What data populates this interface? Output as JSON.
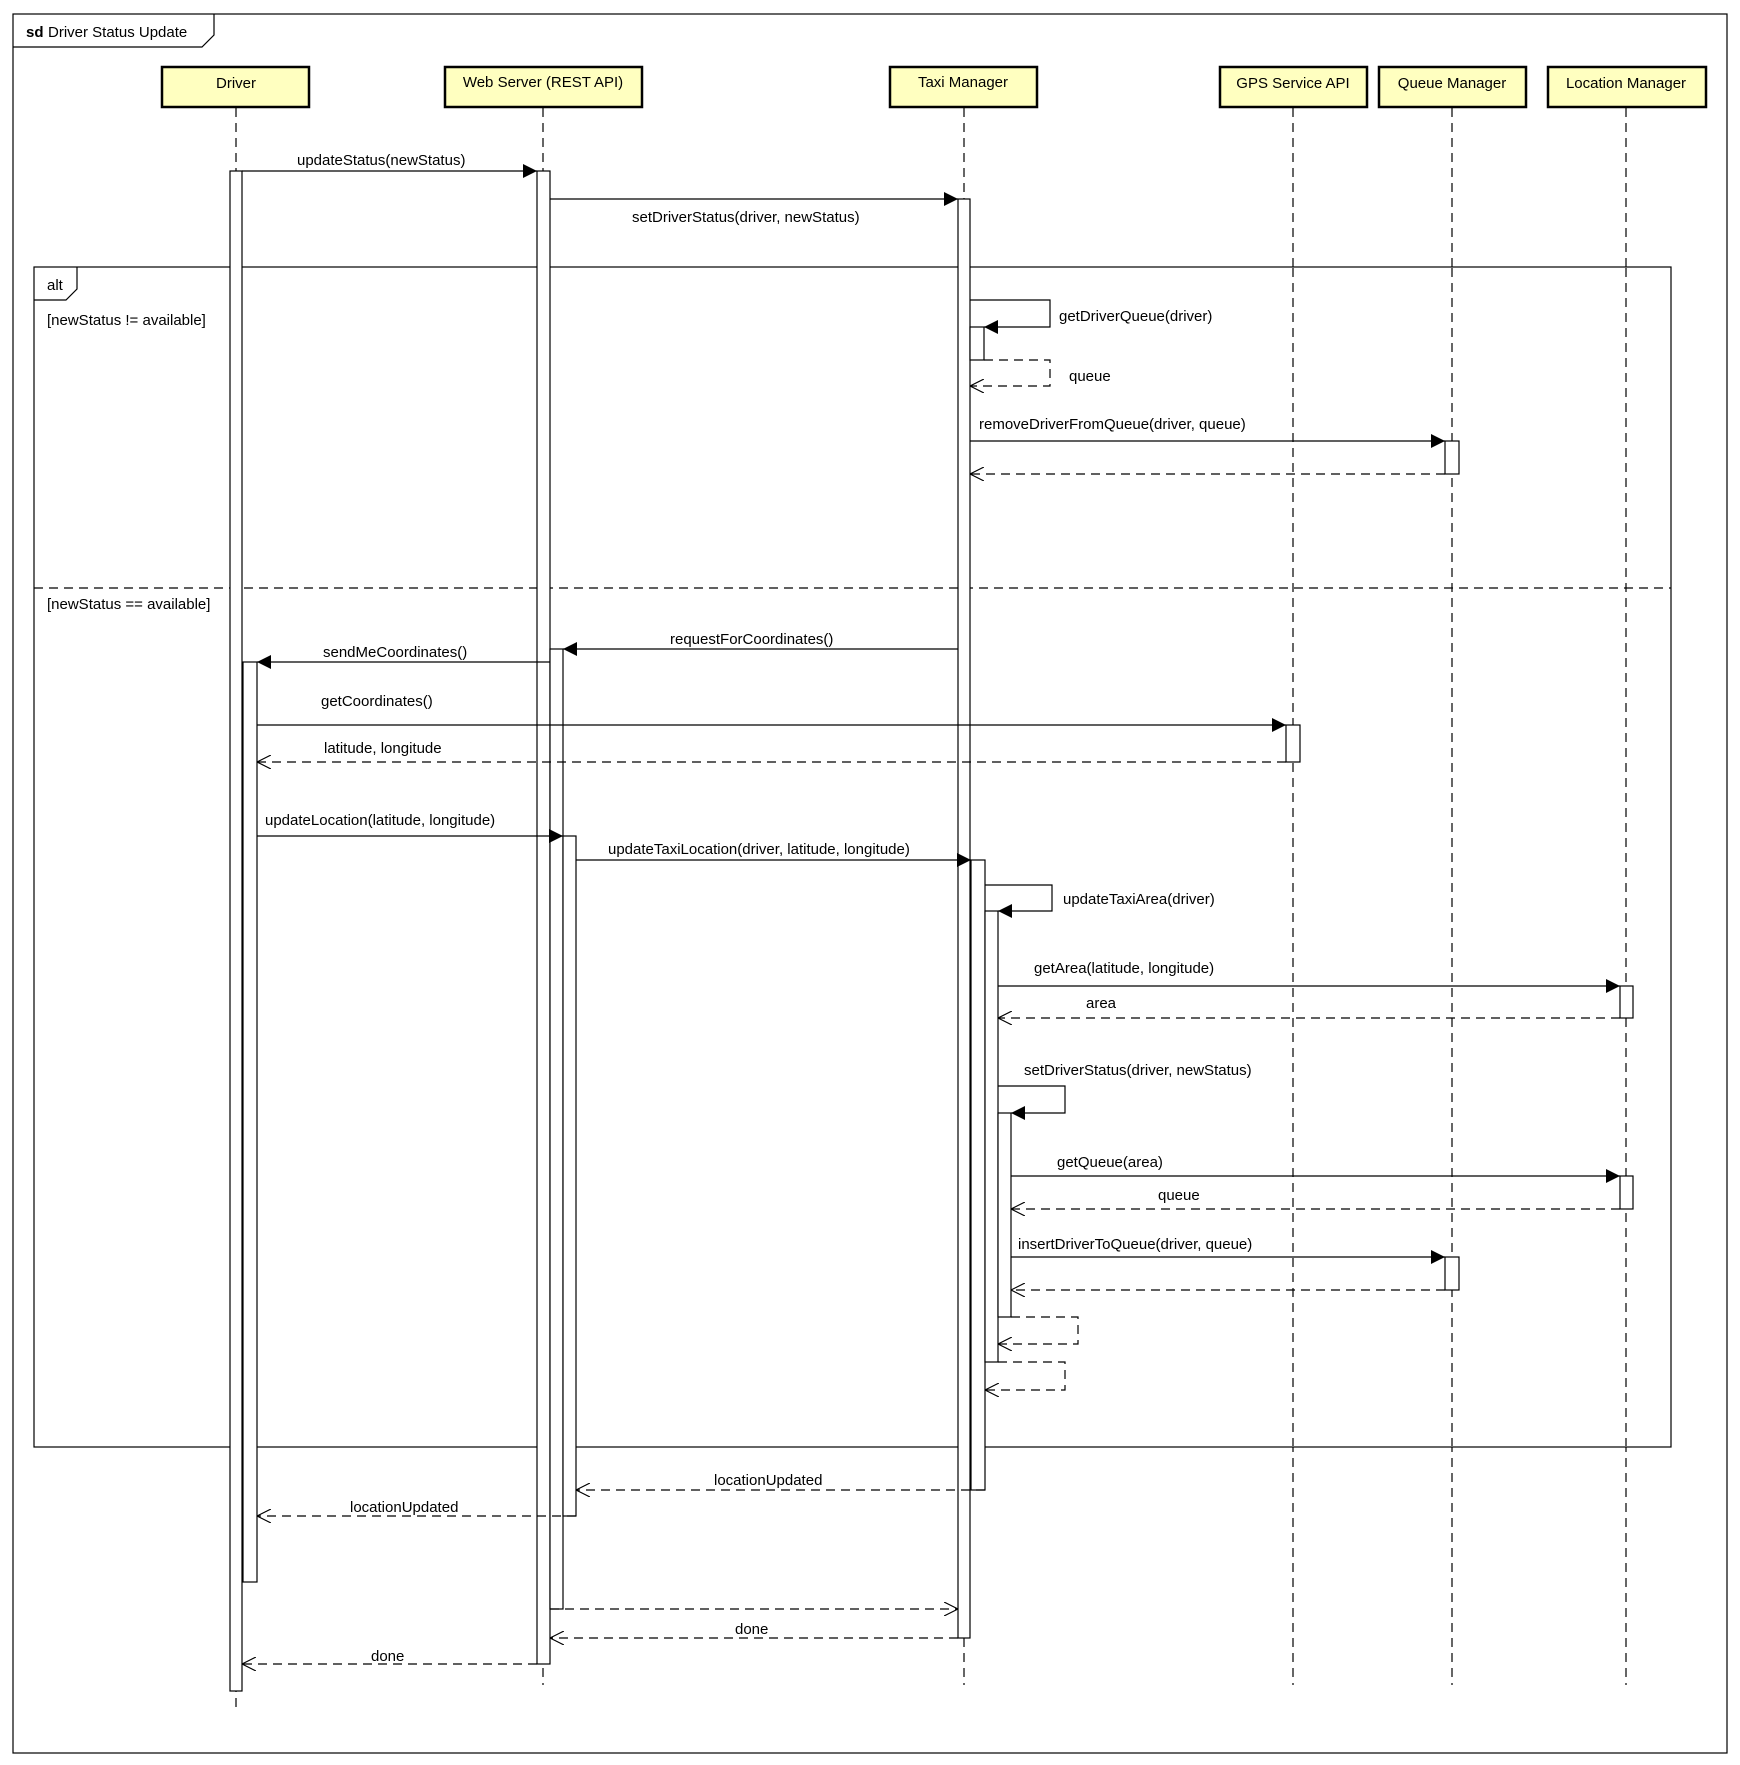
{
  "frame": {
    "keyword": "sd",
    "title": "Driver Status Update"
  },
  "colors": {
    "lifeline_head_fill": "#ffffc0",
    "lifeline_head_stroke": "#000000",
    "line": "#000000",
    "background": "#ffffff"
  },
  "lifelines": [
    {
      "id": "driver",
      "label": "Driver"
    },
    {
      "id": "web",
      "label": "Web Server (REST API)"
    },
    {
      "id": "taxi",
      "label": "Taxi Manager"
    },
    {
      "id": "gps",
      "label": "GPS Service API"
    },
    {
      "id": "queue",
      "label": "Queue Manager"
    },
    {
      "id": "location",
      "label": "Location Manager"
    }
  ],
  "alt": {
    "keyword": "alt",
    "guard1": "[newStatus != available]",
    "guard2": "[newStatus == available]"
  },
  "messages": {
    "m1": "updateStatus(newStatus)",
    "m2": "setDriverStatus(driver, newStatus)",
    "m3": "getDriverQueue(driver)",
    "m3r": "queue",
    "m4": "removeDriverFromQueue(driver, queue)",
    "m5": "requestForCoordinates()",
    "m6": "sendMeCoordinates()",
    "m7": "getCoordinates()",
    "m7r": "latitude, longitude",
    "m8": "updateLocation(latitude, longitude)",
    "m9": "updateTaxiLocation(driver, latitude, longitude)",
    "m10": "updateTaxiArea(driver)",
    "m11": "getArea(latitude, longitude)",
    "m11r": "area",
    "m12": "setDriverStatus(driver, newStatus)",
    "m13": "getQueue(area)",
    "m13r": "queue",
    "m14": "insertDriverToQueue(driver, queue)",
    "m15r": "locationUpdated",
    "m16r": "locationUpdated",
    "m17r": "done",
    "m18r": "done"
  }
}
